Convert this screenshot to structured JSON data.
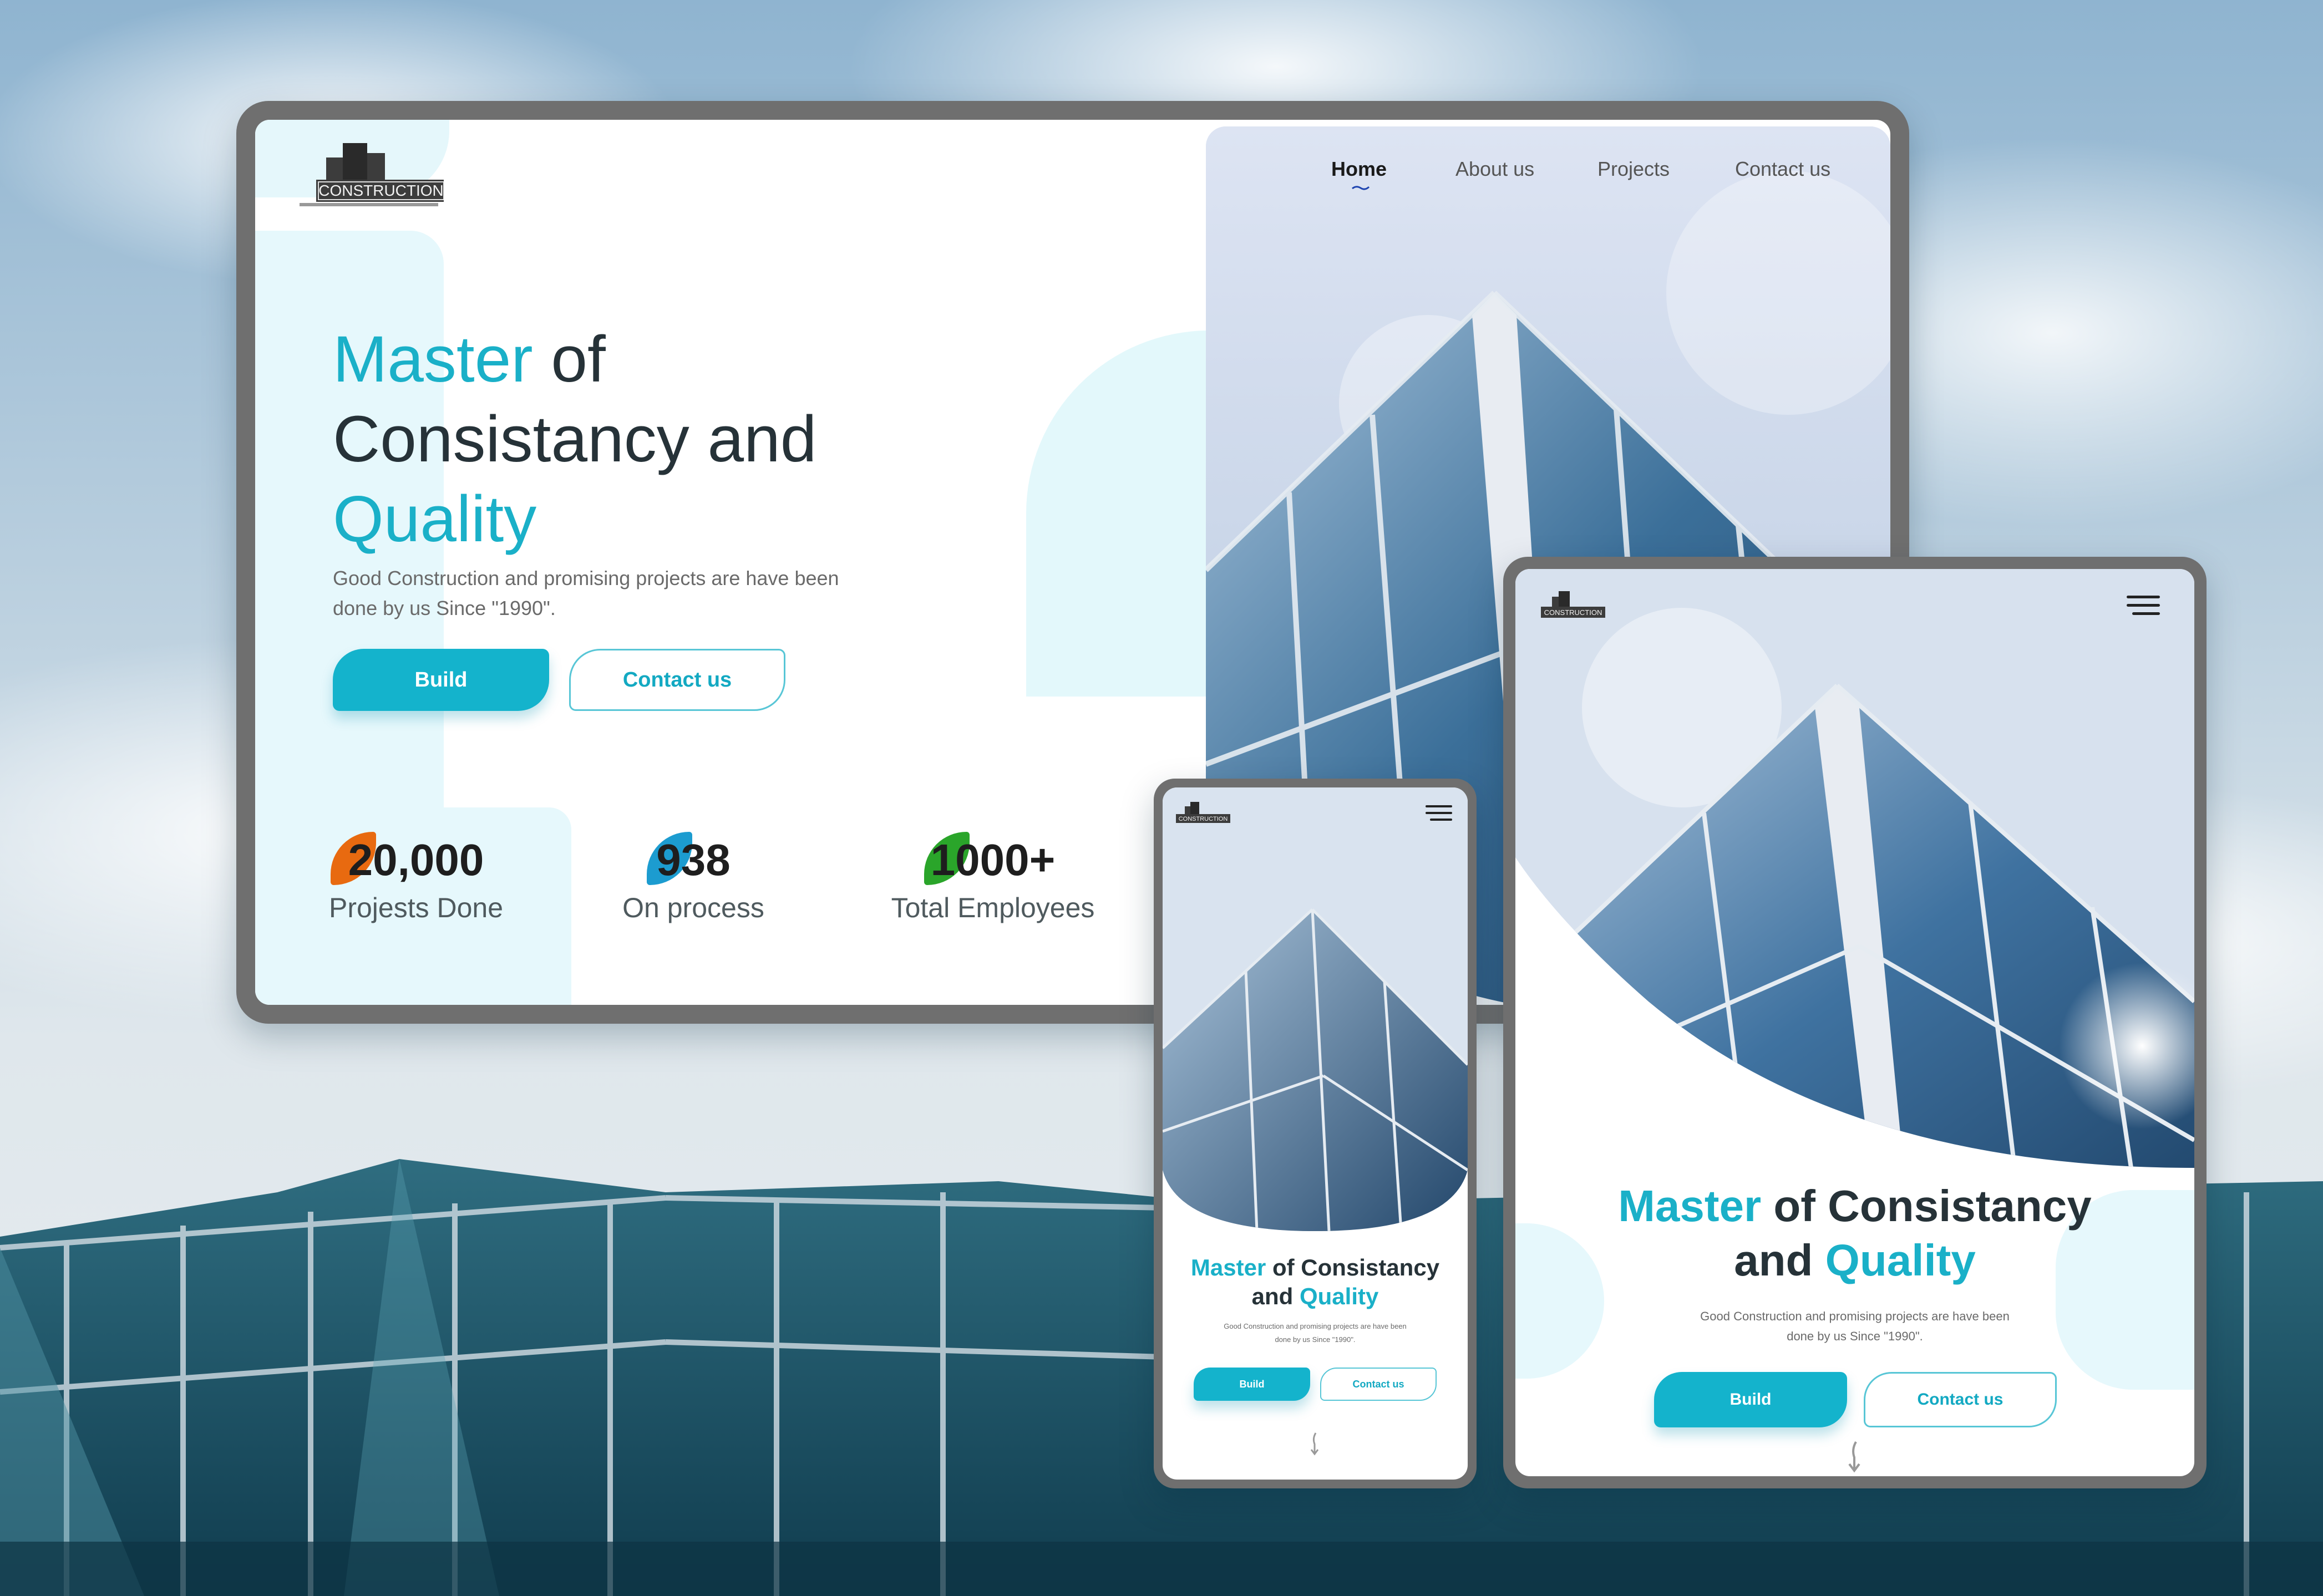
{
  "brand": {
    "logo_text": "CONSTRUCTION",
    "accent_color": "#1ab0c8",
    "button_color": "#14b3cc",
    "tint_color": "#e6f8fc"
  },
  "nav": {
    "items": [
      {
        "label": "Home",
        "active": true
      },
      {
        "label": "About us",
        "active": false
      },
      {
        "label": "Projects",
        "active": false
      },
      {
        "label": "Contact us",
        "active": false
      }
    ],
    "menu_icon": "hamburger-icon"
  },
  "hero": {
    "title_accent_1": "Master",
    "title_mid_1": " of",
    "title_mid_2": "Consistancy and",
    "title_accent_2": "Quality",
    "title_of_consistancy": " of Consistancy",
    "title_and": "and ",
    "subtitle_line1": "Good Construction and promising projects are have been",
    "subtitle_line2": "done by us Since  \"1990\".",
    "build_label": "Build",
    "contact_label": "Contact us"
  },
  "stats": [
    {
      "value": "20,000",
      "label": "Projests Done",
      "blob_color": "#e86a10"
    },
    {
      "value": "938",
      "label": "On process",
      "blob_color": "#1c9cd0"
    },
    {
      "value": "1000+",
      "label": "Total Employees",
      "blob_color": "#2aa52a"
    }
  ],
  "icons": {
    "scroll": "scroll-down-icon",
    "logo": "building-logo-icon"
  }
}
